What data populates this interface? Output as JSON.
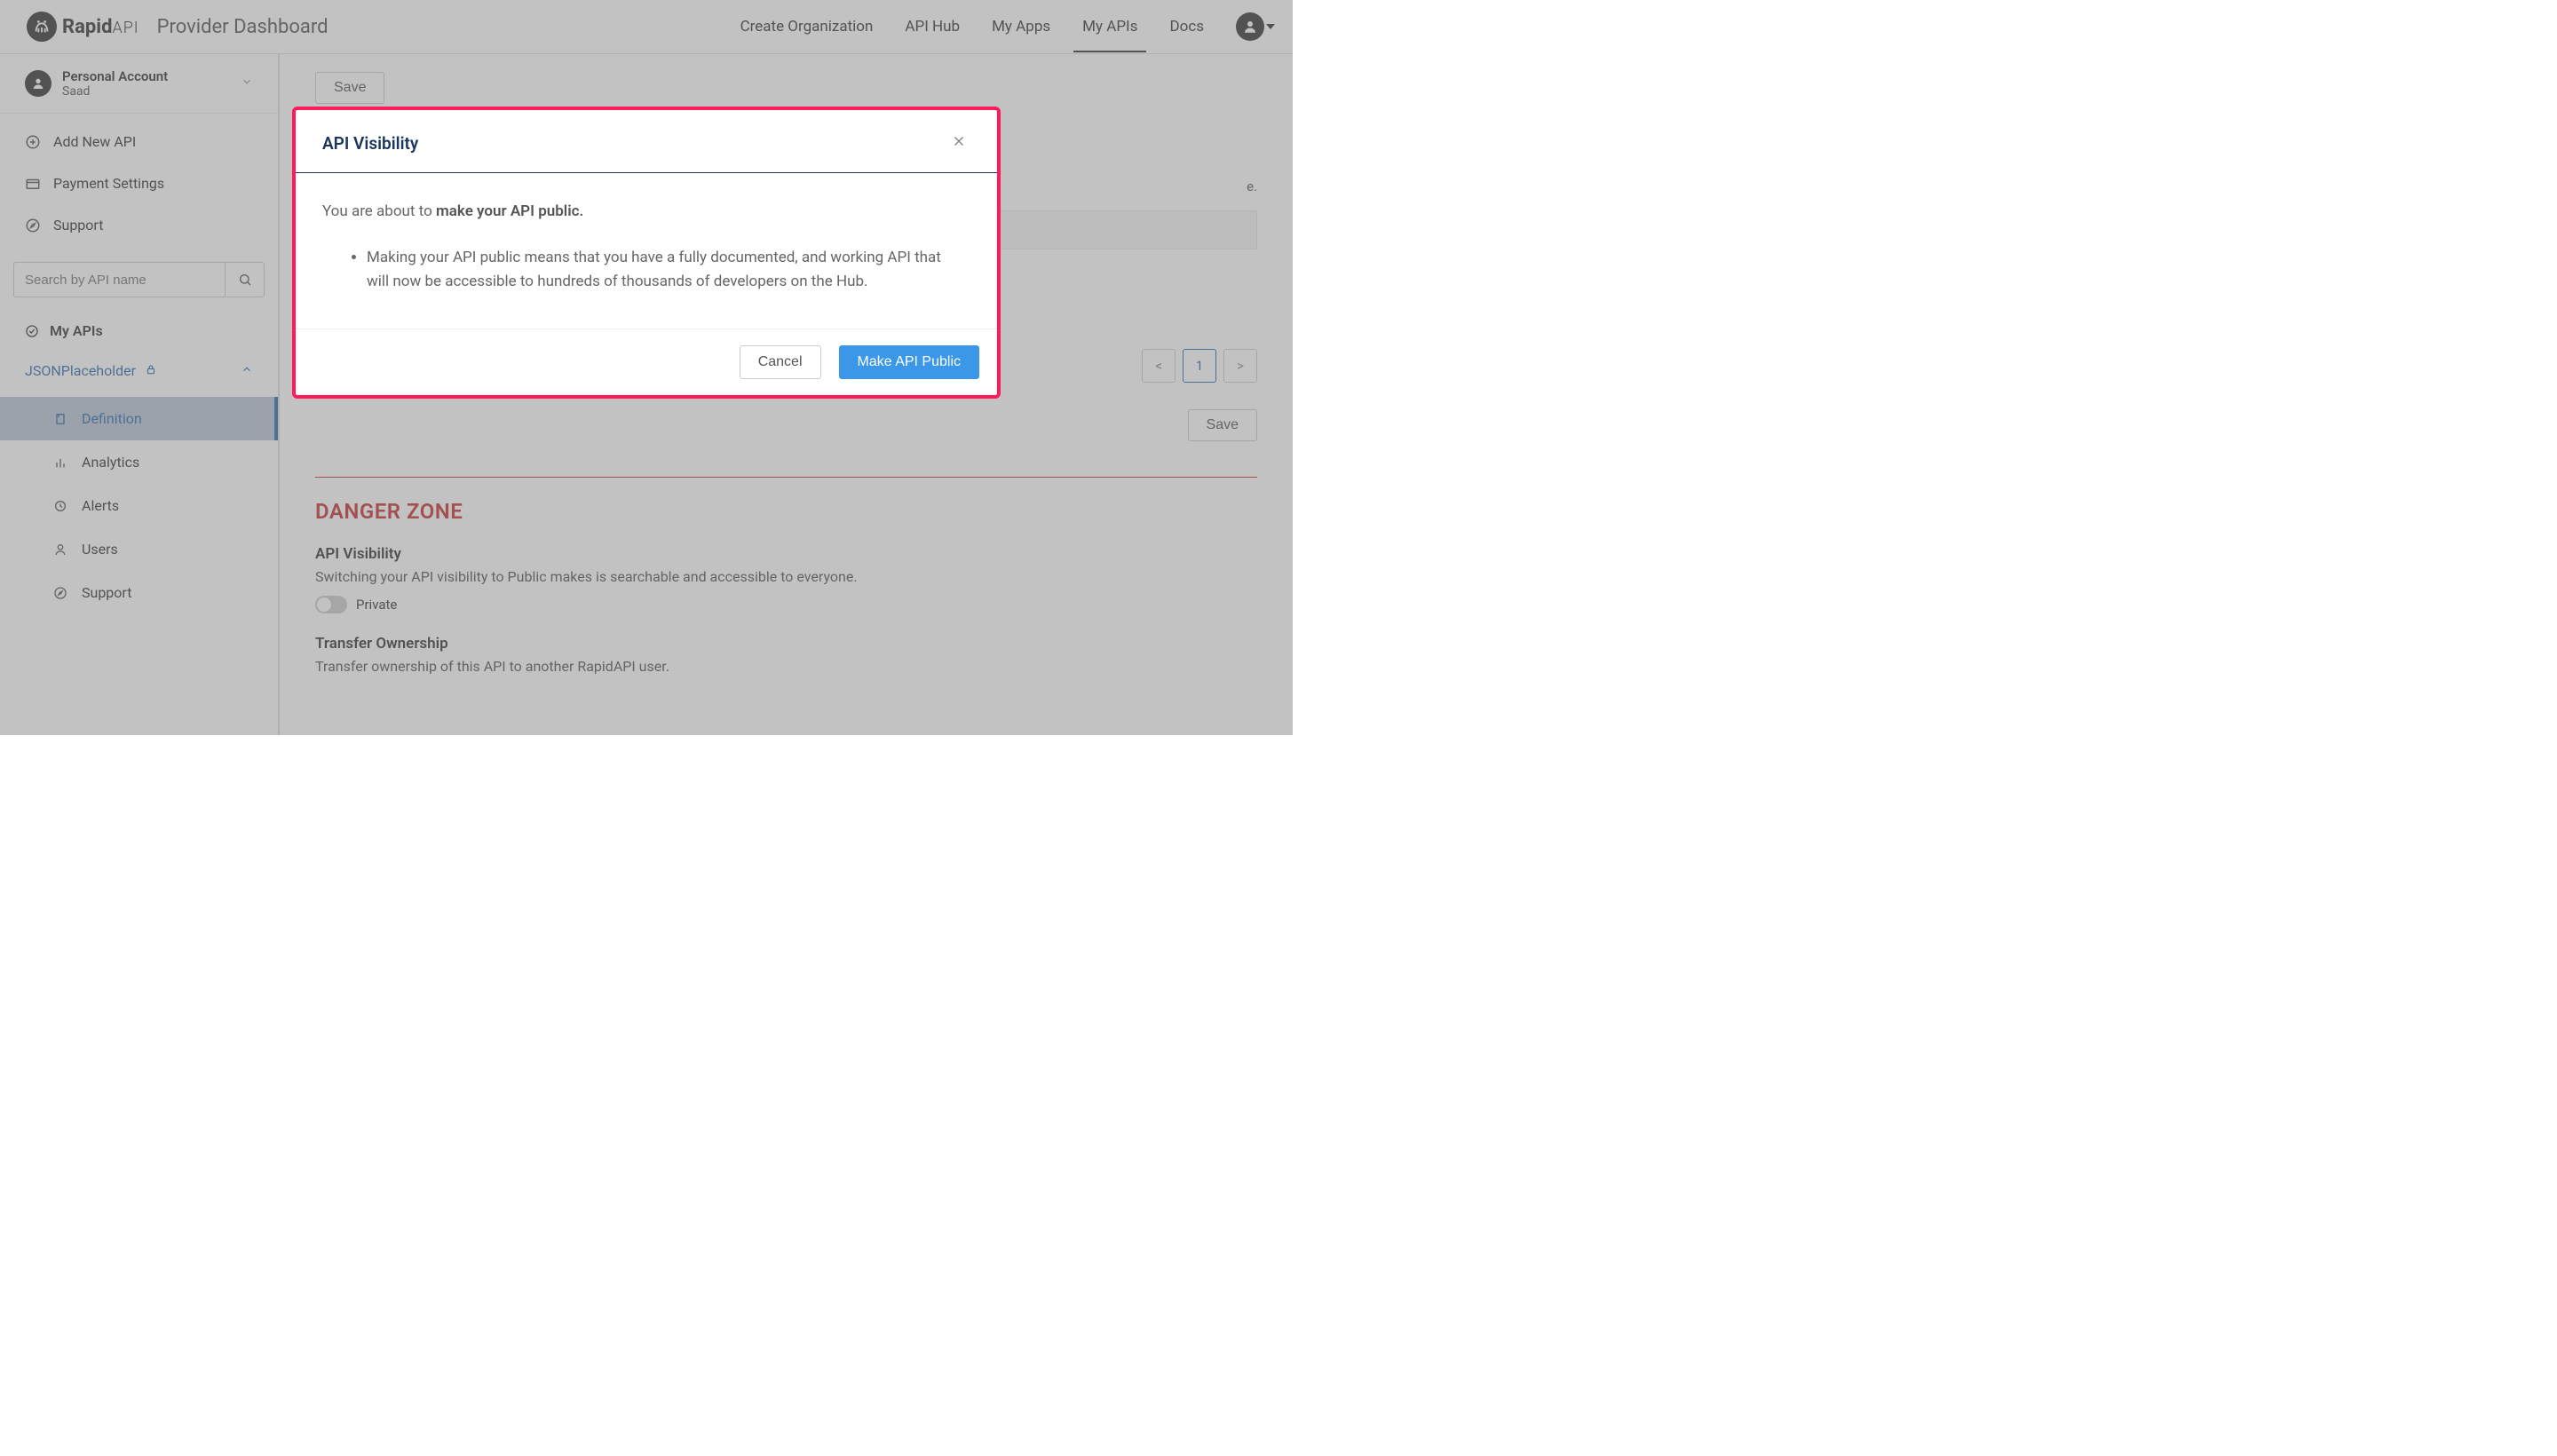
{
  "header": {
    "brand_main": "Rapid",
    "brand_sub": "API",
    "page_title": "Provider Dashboard",
    "nav": {
      "create_org": "Create Organization",
      "api_hub": "API Hub",
      "my_apps": "My Apps",
      "my_apis": "My APIs",
      "docs": "Docs"
    }
  },
  "sidebar": {
    "account": {
      "title": "Personal Account",
      "name": "Saad"
    },
    "items": {
      "add_new": "Add New API",
      "payment": "Payment Settings",
      "support": "Support"
    },
    "search_placeholder": "Search by API name",
    "my_apis_label": "My APIs",
    "api": {
      "name": "JSONPlaceholder",
      "sub": {
        "definition": "Definition",
        "analytics": "Analytics",
        "alerts": "Alerts",
        "users": "Users",
        "support": "Support"
      }
    }
  },
  "content": {
    "save_label": "Save",
    "pager": {
      "prev": "<",
      "page": "1",
      "next": ">"
    },
    "danger": {
      "title": "DANGER ZONE",
      "visibility_h": "API Visibility",
      "visibility_t": "Switching your API visibility to Public makes is searchable and accessible to everyone.",
      "private_label": "Private",
      "transfer_h": "Transfer Ownership",
      "transfer_t": "Transfer ownership of this API to another RapidAPI user."
    }
  },
  "modal": {
    "title": "API Visibility",
    "body_prefix": "You are about to ",
    "body_strong": "make your API public.",
    "bullet": "Making your API public means that you have a fully documented, and working API that will now be accessible to hundreds of thousands of developers on the Hub.",
    "cancel": "Cancel",
    "confirm": "Make API Public"
  }
}
